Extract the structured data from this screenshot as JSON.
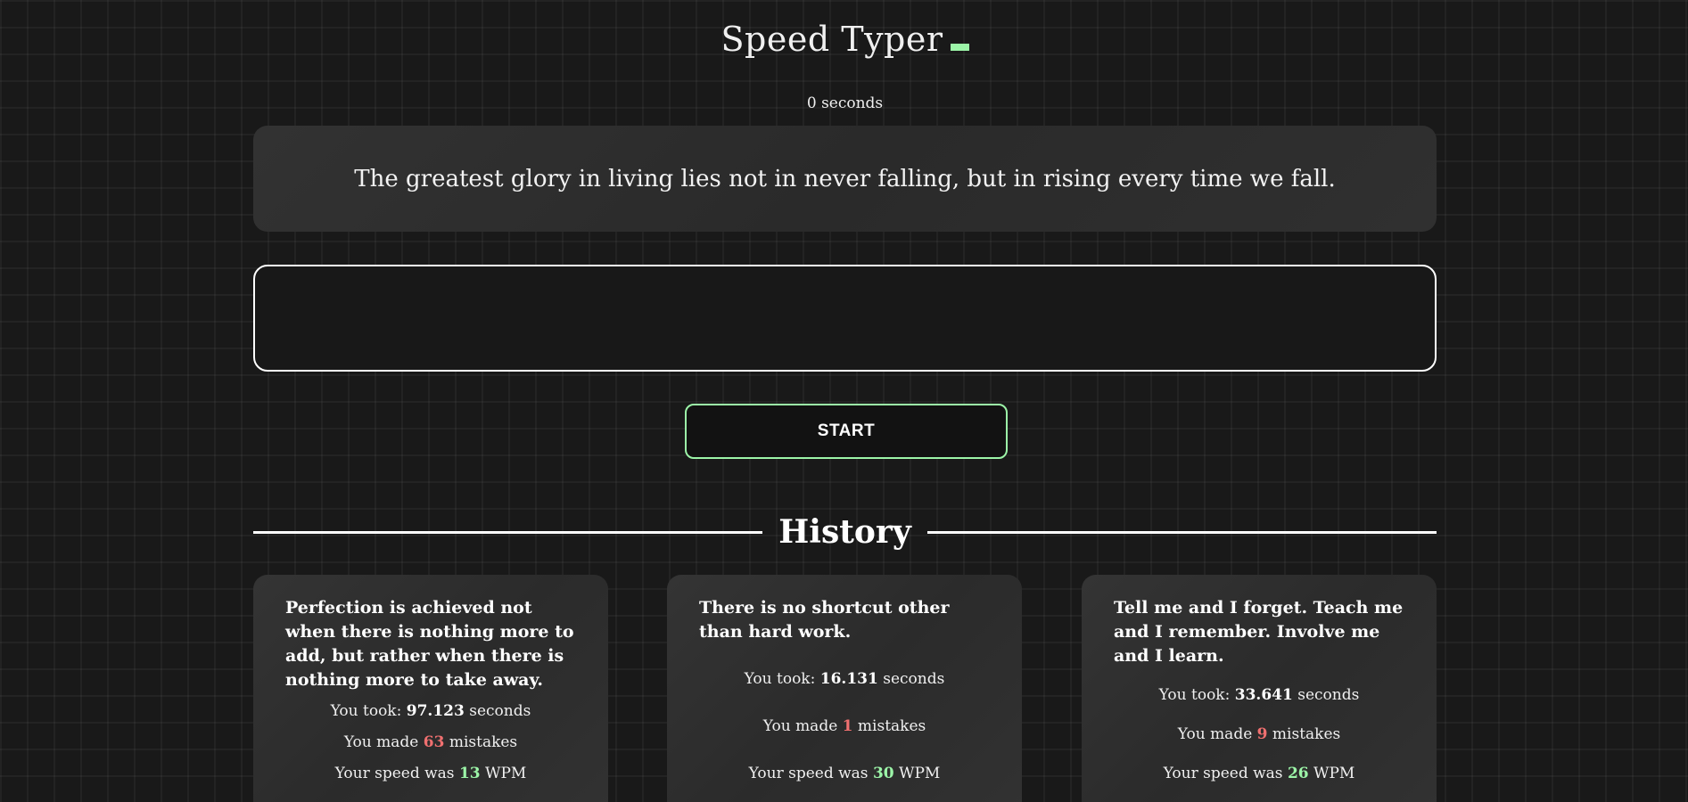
{
  "app": {
    "title": "Speed Typer",
    "timer_value": "0",
    "timer_unit": "seconds",
    "accent_color": "#9cf5a8",
    "error_color": "#f07070"
  },
  "quote": {
    "text": "The greatest glory in living lies not in never falling, but in rising every time we fall."
  },
  "input": {
    "value": "",
    "placeholder": ""
  },
  "start_button": {
    "label": "START"
  },
  "history": {
    "heading": "History",
    "items": [
      {
        "quote": "Perfection is achieved not when there is nothing more to add, but rather when there is nothing more to take away.",
        "took_prefix": "You took: ",
        "time": "97.123",
        "took_suffix": " seconds",
        "mistakes_prefix": "You made ",
        "mistakes": "63",
        "mistakes_suffix": " mistakes",
        "speed_prefix": "Your speed was ",
        "wpm": "13",
        "speed_suffix": " WPM"
      },
      {
        "quote": "There is no shortcut other than hard work.",
        "took_prefix": "You took: ",
        "time": "16.131",
        "took_suffix": " seconds",
        "mistakes_prefix": "You made ",
        "mistakes": "1",
        "mistakes_suffix": " mistakes",
        "speed_prefix": "Your speed was ",
        "wpm": "30",
        "speed_suffix": " WPM"
      },
      {
        "quote": "Tell me and I forget. Teach me and I remember. Involve me and I learn.",
        "took_prefix": "You took: ",
        "time": "33.641",
        "took_suffix": " seconds",
        "mistakes_prefix": "You made ",
        "mistakes": "9",
        "mistakes_suffix": " mistakes",
        "speed_prefix": "Your speed was ",
        "wpm": "26",
        "speed_suffix": " WPM"
      }
    ]
  }
}
